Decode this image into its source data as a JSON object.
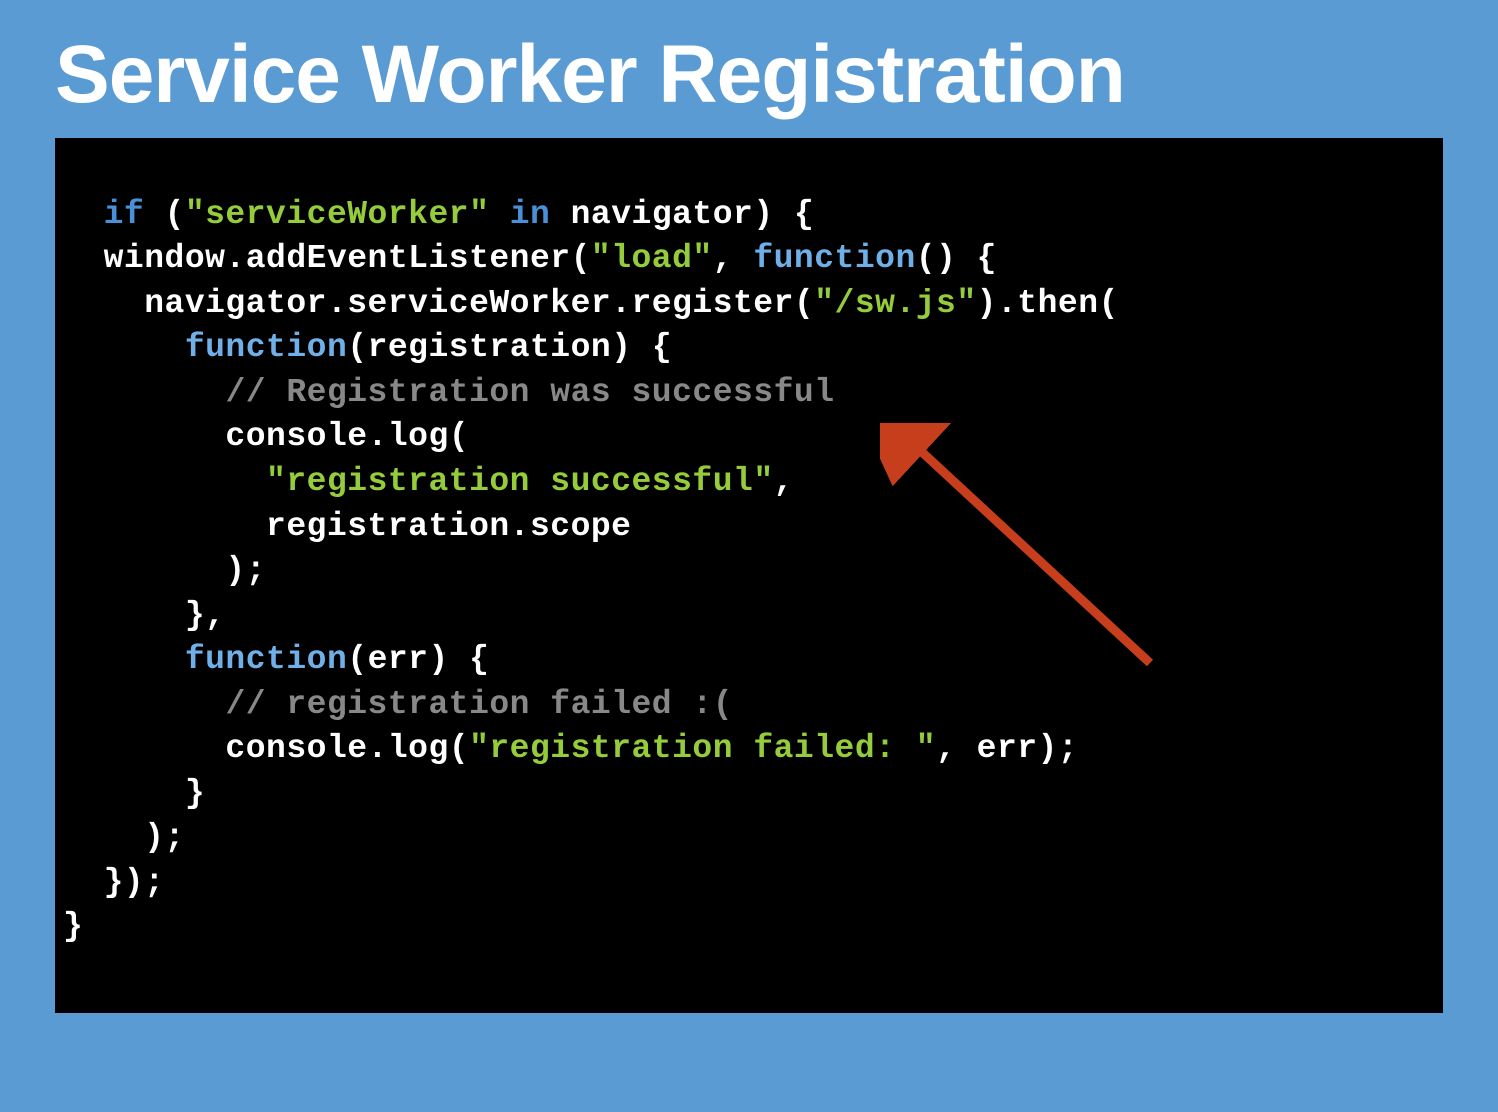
{
  "slide": {
    "title": "Service Worker Registration"
  },
  "code": {
    "tokens": [
      {
        "t": "keyword",
        "v": "if"
      },
      {
        "t": "plain",
        "v": " ("
      },
      {
        "t": "string",
        "v": "\"serviceWorker\""
      },
      {
        "t": "plain",
        "v": " "
      },
      {
        "t": "keyword",
        "v": "in"
      },
      {
        "t": "plain",
        "v": " navigator) {\n"
      },
      {
        "t": "plain",
        "v": "  window.addEventListener("
      },
      {
        "t": "string",
        "v": "\"load\""
      },
      {
        "t": "plain",
        "v": ", "
      },
      {
        "t": "func",
        "v": "function"
      },
      {
        "t": "plain",
        "v": "() {\n"
      },
      {
        "t": "plain",
        "v": "    navigator.serviceWorker.register("
      },
      {
        "t": "string",
        "v": "\"/sw.js\""
      },
      {
        "t": "plain",
        "v": ").then(\n"
      },
      {
        "t": "plain",
        "v": "      "
      },
      {
        "t": "func",
        "v": "function"
      },
      {
        "t": "plain",
        "v": "(registration) {\n"
      },
      {
        "t": "plain",
        "v": "        "
      },
      {
        "t": "comment",
        "v": "// Registration was successful"
      },
      {
        "t": "plain",
        "v": "\n"
      },
      {
        "t": "plain",
        "v": "        console.log(\n"
      },
      {
        "t": "plain",
        "v": "          "
      },
      {
        "t": "string",
        "v": "\"registration successful\""
      },
      {
        "t": "plain",
        "v": ",\n"
      },
      {
        "t": "plain",
        "v": "          registration.scope\n"
      },
      {
        "t": "plain",
        "v": "        );\n"
      },
      {
        "t": "plain",
        "v": "      },\n"
      },
      {
        "t": "plain",
        "v": "      "
      },
      {
        "t": "func",
        "v": "function"
      },
      {
        "t": "plain",
        "v": "(err) {\n"
      },
      {
        "t": "plain",
        "v": "        "
      },
      {
        "t": "comment",
        "v": "// registration failed :("
      },
      {
        "t": "plain",
        "v": "\n"
      },
      {
        "t": "plain",
        "v": "        console.log("
      },
      {
        "t": "string",
        "v": "\"registration failed: \""
      },
      {
        "t": "plain",
        "v": ", err);\n"
      },
      {
        "t": "plain",
        "v": "      }\n"
      },
      {
        "t": "plain",
        "v": "    );\n"
      },
      {
        "t": "plain",
        "v": "  });\n"
      },
      {
        "t": "plain",
        "v": "}"
      }
    ]
  },
  "annotation": {
    "arrow_color": "#c73e1d"
  }
}
